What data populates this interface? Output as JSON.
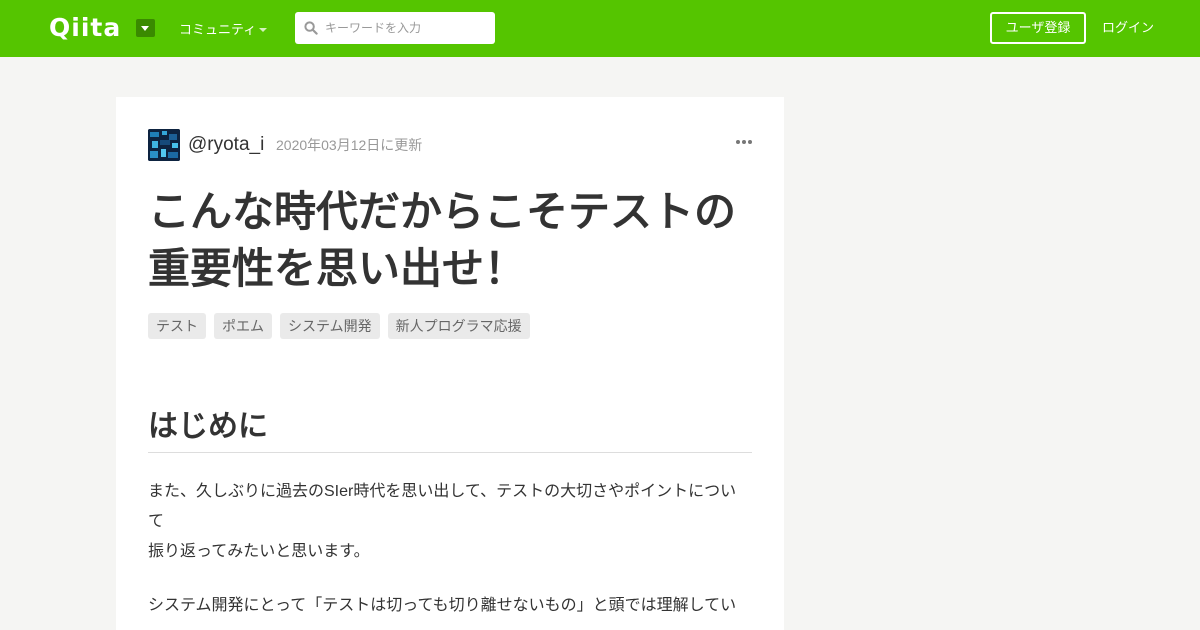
{
  "header": {
    "logo": "Qiita",
    "community_label": "コミュニティ",
    "search_placeholder": "キーワードを入力",
    "signup_label": "ユーザ登録",
    "login_label": "ログイン"
  },
  "colors": {
    "brand": "#55c500",
    "background": "#f5f5f3"
  },
  "icons": {
    "logo_menu": "caret-down-icon",
    "community_menu": "chevron-down-icon",
    "search": "search-icon",
    "more": "more-icon"
  },
  "article": {
    "author": "@ryota_i",
    "updated": "2020年03月12日に更新",
    "title_line1": "こんな時代だからこそテストの",
    "title_line2": "重要性を思い出せ！",
    "tags": [
      "テスト",
      "ポエム",
      "システム開発",
      "新人プログラマ応援"
    ],
    "heading": "はじめに",
    "para1_line1": "また、久しぶりに過去のSIer時代を思い出して、テストの大切さやポイントについ",
    "para1_line2": "て",
    "para1_line3": "振り返ってみたいと思います。",
    "para2_line1": "システム開発にとって「テストは切っても切り離せないもの」と頭では理解してい"
  }
}
